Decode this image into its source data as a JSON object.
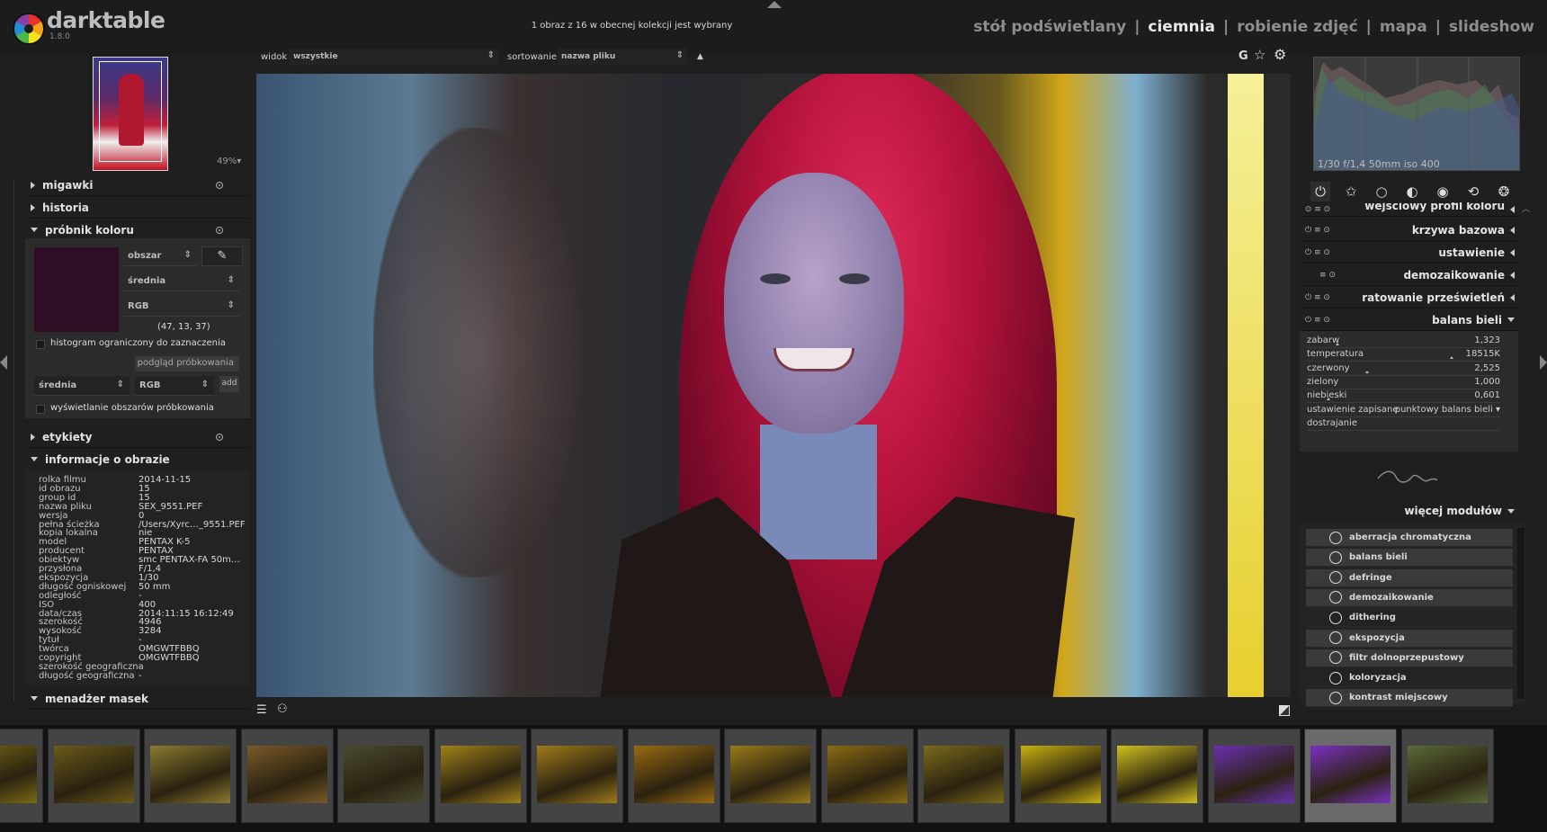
{
  "app": {
    "name": "darktable",
    "version": "1.8.0"
  },
  "status_message": "1 obraz z 16 w obecnej kolekcji jest wybrany",
  "views": [
    {
      "label": "stół podświetlany",
      "active": false
    },
    {
      "label": "ciemnia",
      "active": true
    },
    {
      "label": "robienie zdjęć",
      "active": false
    },
    {
      "label": "mapa",
      "active": false
    },
    {
      "label": "slideshow",
      "active": false
    }
  ],
  "view_separator": "|",
  "navigation": {
    "zoom": "49%▾"
  },
  "left_modules": {
    "snapshots": "migawki",
    "history": "historia",
    "color_picker": "próbnik koloru",
    "tags": "etykiety",
    "image_info": "informacje o obrazie",
    "mask_manager": "menadżer masek"
  },
  "color_picker": {
    "mode": "obszar",
    "stat": "średnia",
    "colorspace": "RGB",
    "values": "(47, 13, 37)",
    "swatch_color": "#2f0d25",
    "histogram_restrict_label": "histogram ograniczony do zaznaczenia",
    "preview_button": "podgląd próbkowania",
    "sample_stat": "średnia",
    "sample_colorspace": "RGB",
    "add_button": "add",
    "show_areas_label": "wyświetlanie obszarów próbkowania",
    "picker_icon": "eyedropper-icon"
  },
  "image_info": [
    {
      "label": "rolka filmu",
      "value": "2014-11-15"
    },
    {
      "label": "id obrazu",
      "value": "15"
    },
    {
      "label": "group id",
      "value": "15"
    },
    {
      "label": "nazwa pliku",
      "value": "SEX_9551.PEF"
    },
    {
      "label": "wersja",
      "value": "0"
    },
    {
      "label": "pełna ścieżka",
      "value": "/Users/Xyrc…_9551.PEF"
    },
    {
      "label": "kopia lokalna",
      "value": "nie"
    },
    {
      "label": "model",
      "value": "PENTAX K-5"
    },
    {
      "label": "producent",
      "value": "PENTAX"
    },
    {
      "label": "obiektyw",
      "value": "smc PENTAX-FA 50m…"
    },
    {
      "label": "przysłona",
      "value": "F/1,4"
    },
    {
      "label": "ekspozycja",
      "value": "1/30"
    },
    {
      "label": "długość ogniskowej",
      "value": "50 mm"
    },
    {
      "label": "odległość",
      "value": "-"
    },
    {
      "label": "ISO",
      "value": "400"
    },
    {
      "label": "data/czas",
      "value": "2014:11:15 16:12:49"
    },
    {
      "label": "szerokość",
      "value": "4946"
    },
    {
      "label": "wysokość",
      "value": "3284"
    },
    {
      "label": "tytuł",
      "value": "-"
    },
    {
      "label": "twórca",
      "value": "OMGWTFBBQ"
    },
    {
      "label": "copyright",
      "value": "OMGWTFBBQ"
    },
    {
      "label": "szerokość geograficzna",
      "value": "-"
    },
    {
      "label": "długość geograficzna",
      "value": "-"
    }
  ],
  "center_toolbar": {
    "view_label": "widok",
    "view_value": "wszystkie",
    "sort_label": "sortowanie",
    "sort_value": "nazwa pliku",
    "sort_direction": "▲",
    "grouping": "G",
    "star_icon": "☆",
    "gear_icon": "⚙"
  },
  "bottom_toolbar": {
    "menu_icon": "☰",
    "styles_icon": "⚇"
  },
  "histogram": {
    "exif": "1/30 f/1,4 50mm iso 400"
  },
  "module_groups": [
    "⏻",
    "✩",
    "○",
    "◐",
    "◉",
    "⟲",
    "❂"
  ],
  "right_modules": [
    {
      "label": "wejściowy profil koloru",
      "icons": "⊙ ≡ ⊙"
    },
    {
      "label": "krzywa bazowa",
      "icons": "⏻ ≡ ⊙"
    },
    {
      "label": "ustawienie",
      "icons": "⏻ ≡ ⊙"
    },
    {
      "label": "demozaikowanie",
      "icons": "≡ ⊙"
    },
    {
      "label": "ratowanie prześwietleń",
      "icons": "⏻ ≡ ⊙"
    },
    {
      "label": "balans bieli",
      "icons": "⏻ ≡ ⊙"
    }
  ],
  "white_balance": [
    {
      "label": "zabarw",
      "value": "1,323",
      "pos": 0.15
    },
    {
      "label": "temperatura",
      "value": "18515K",
      "pos": 0.74
    },
    {
      "label": "czerwony",
      "value": "2,525",
      "pos": 0.3
    },
    {
      "label": "zielony",
      "value": "1,000",
      "pos": -1
    },
    {
      "label": "niebieski",
      "value": "0,601",
      "pos": 0.1
    },
    {
      "label": "ustawienie zapisane",
      "value": "punktowy balans bieli ▾",
      "pos": -1
    },
    {
      "label": "dostrajanie",
      "value": "",
      "pos": -1
    }
  ],
  "more_modules": {
    "label": "więcej modułów",
    "items": [
      {
        "label": "aberracja chromatyczna",
        "icon": "color-wheel-icon"
      },
      {
        "label": "balans bieli",
        "icon": "thermometer-icon"
      },
      {
        "label": "defringe",
        "icon": "circle-icon"
      },
      {
        "label": "demozaikowanie",
        "icon": "color-wheel-icon"
      },
      {
        "label": "dithering",
        "icon": "dither-icon"
      },
      {
        "label": "ekspozycja",
        "icon": "exposure-icon"
      },
      {
        "label": "filtr dolnoprzepustowy",
        "icon": "lowpass-icon"
      },
      {
        "label": "koloryzacja",
        "icon": "circle-icon"
      },
      {
        "label": "kontrast miejscowy",
        "icon": "circle-icon"
      }
    ]
  },
  "filmstrip": [
    {
      "color": "#7a6a14"
    },
    {
      "color": "#6a5a1a"
    },
    {
      "color": "#8a7a30"
    },
    {
      "color": "#7a5a2a"
    },
    {
      "color": "#4a4a30"
    },
    {
      "color": "#a0801a"
    },
    {
      "color": "#a07a1a"
    },
    {
      "color": "#9a6a12"
    },
    {
      "color": "#9a7a1a"
    },
    {
      "color": "#8a6a14"
    },
    {
      "color": "#7a6a1a"
    },
    {
      "color": "#c8b010"
    },
    {
      "color": "#d0c020"
    },
    {
      "color": "#6a30b0"
    },
    {
      "color": "#7a30c0"
    },
    {
      "color": "#5a6a3a"
    }
  ],
  "accent": "#e8e8e8"
}
